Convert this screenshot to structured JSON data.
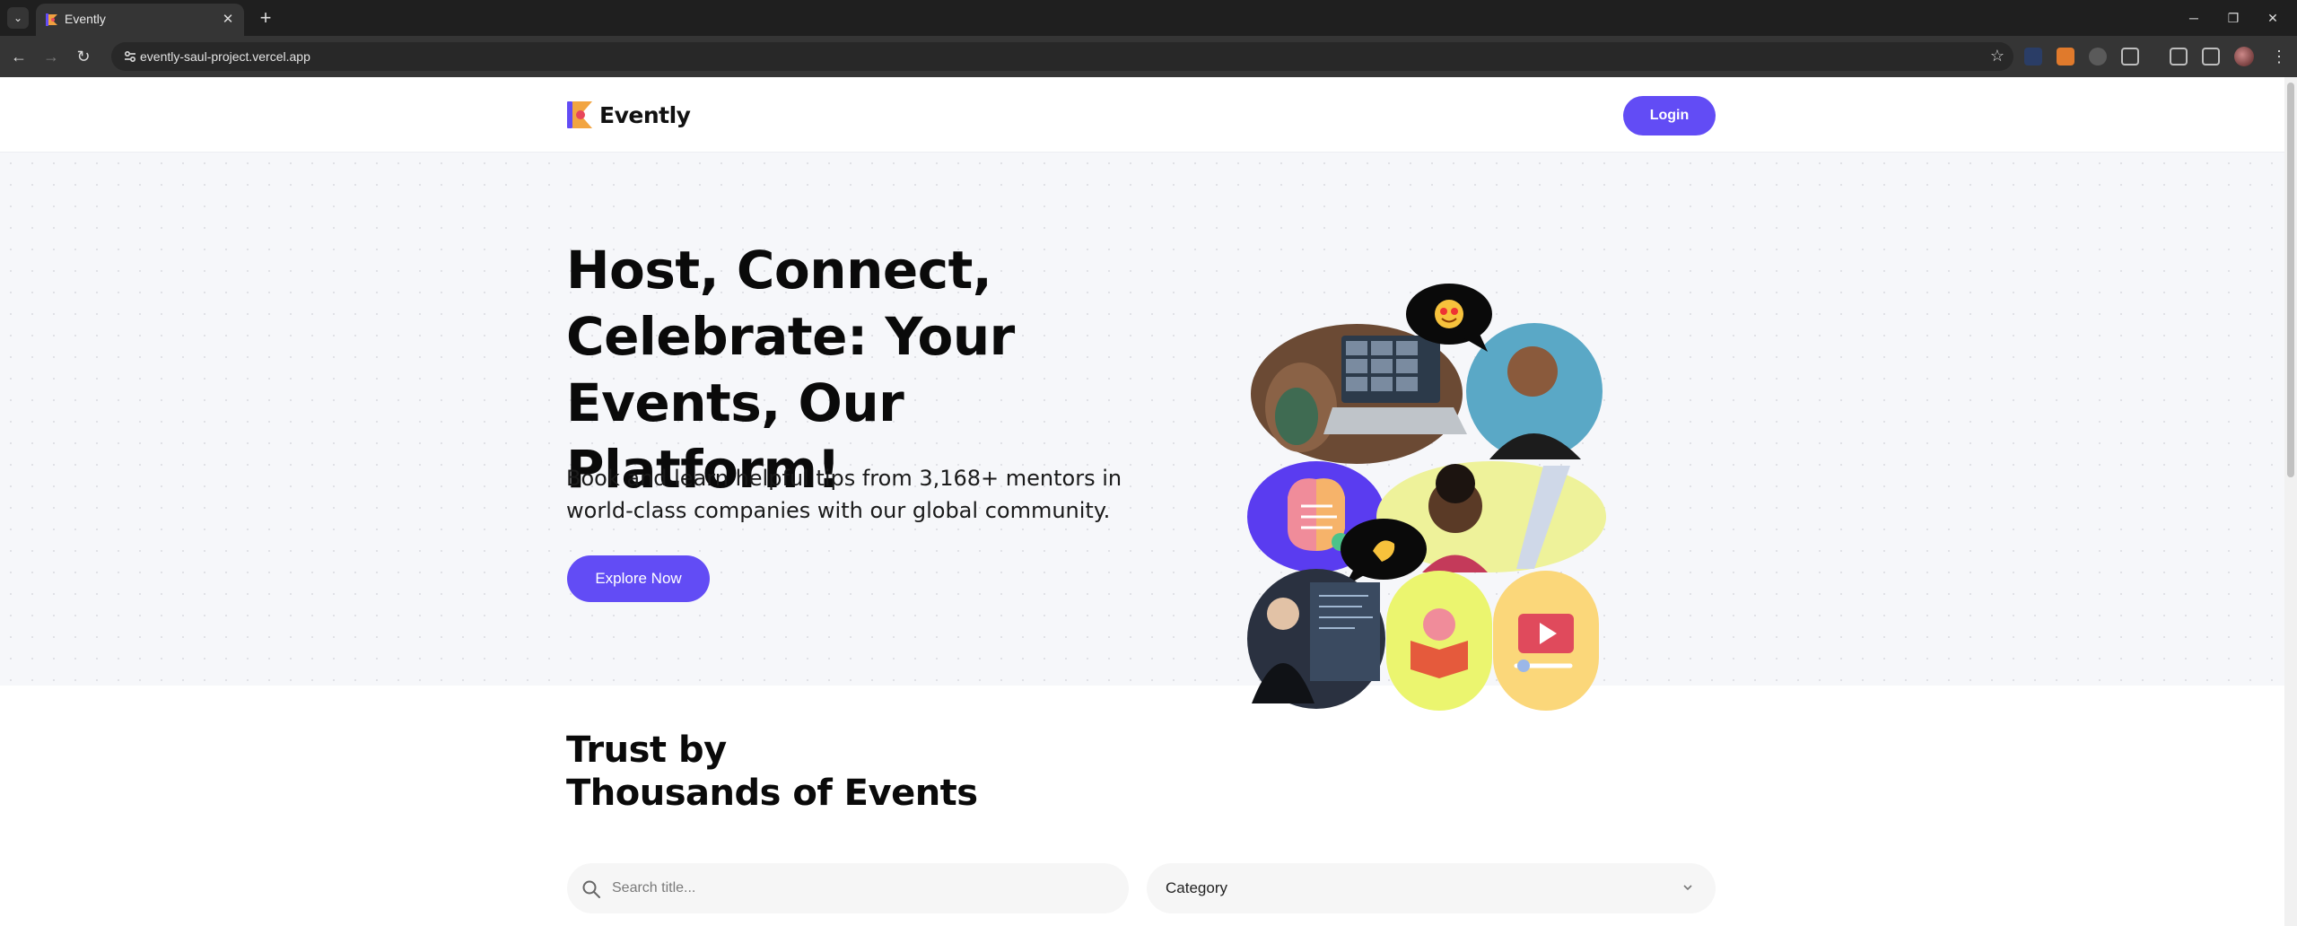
{
  "browser": {
    "tab_title": "Evently",
    "url": "evently-saul-project.vercel.app",
    "new_tab_symbol": "+",
    "close_symbol": "✕",
    "tab_list_symbol": "⌄",
    "minimize_symbol": "─",
    "restore_symbol": "❐",
    "window_close_symbol": "✕",
    "back_symbol": "←",
    "forward_symbol": "→",
    "reload_symbol": "↻",
    "bookmark_symbol": "☆",
    "menu_symbol": "⋮"
  },
  "header": {
    "logo_text": "Evently",
    "login_label": "Login"
  },
  "hero": {
    "title": "Host, Connect, Celebrate: Your Events, Our Platform!",
    "subtitle": "Book and learn helpful tips from 3,168+ mentors in world-class companies with our global community.",
    "cta_label": "Explore Now"
  },
  "events_section": {
    "title_line1": "Trust by",
    "title_line2": "Thousands of Events",
    "search_placeholder": "Search title...",
    "category_label": "Category"
  },
  "colors": {
    "primary": "#624cf5",
    "hero_bg": "#f6f7fa",
    "illustration_yellow": "#ebf56f",
    "illustration_orange": "#fbd77a",
    "illustration_purple": "#5a3cf0"
  }
}
